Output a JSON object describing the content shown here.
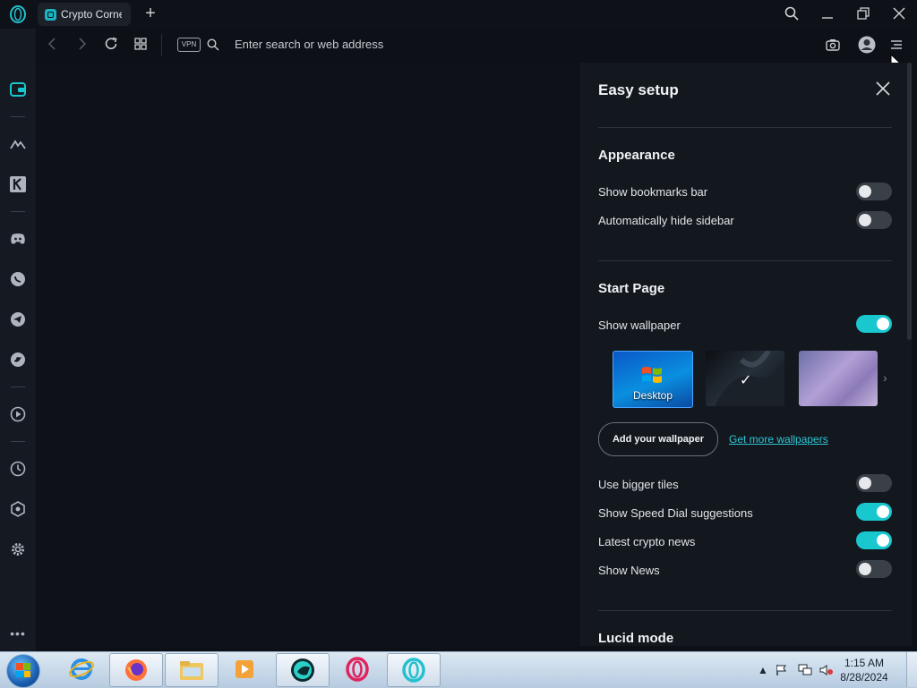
{
  "browser": {
    "tab_title": "Crypto Corner",
    "new_tab_symbol": "+",
    "address_placeholder": "Enter search or web address",
    "vpn_label": "VPN"
  },
  "panel": {
    "title": "Easy setup",
    "sections": {
      "appearance": "Appearance",
      "start_page": "Start Page",
      "lucid_mode": "Lucid mode"
    },
    "appearance_rows": [
      {
        "label": "Show bookmarks bar",
        "on": false
      },
      {
        "label": "Automatically hide sidebar",
        "on": false
      }
    ],
    "start_rows": [
      {
        "label": "Show wallpaper",
        "on": true
      }
    ],
    "wallpapers": [
      {
        "label": "Desktop",
        "selected": false
      },
      {
        "label": "",
        "selected": true
      },
      {
        "label": "",
        "selected": false
      }
    ],
    "add_wallpaper_label": "Add your wallpaper",
    "get_more_label": "Get more wallpapers",
    "tile_rows": [
      {
        "label": "Use bigger tiles",
        "on": false
      },
      {
        "label": "Show Speed Dial suggestions",
        "on": true
      },
      {
        "label": "Latest crypto news",
        "on": true
      },
      {
        "label": "Show News",
        "on": false
      }
    ]
  },
  "taskbar": {
    "time": "1:15 AM",
    "date": "8/28/2024"
  },
  "colors": {
    "accent": "#19c7cf",
    "link": "#2fc6d6"
  }
}
